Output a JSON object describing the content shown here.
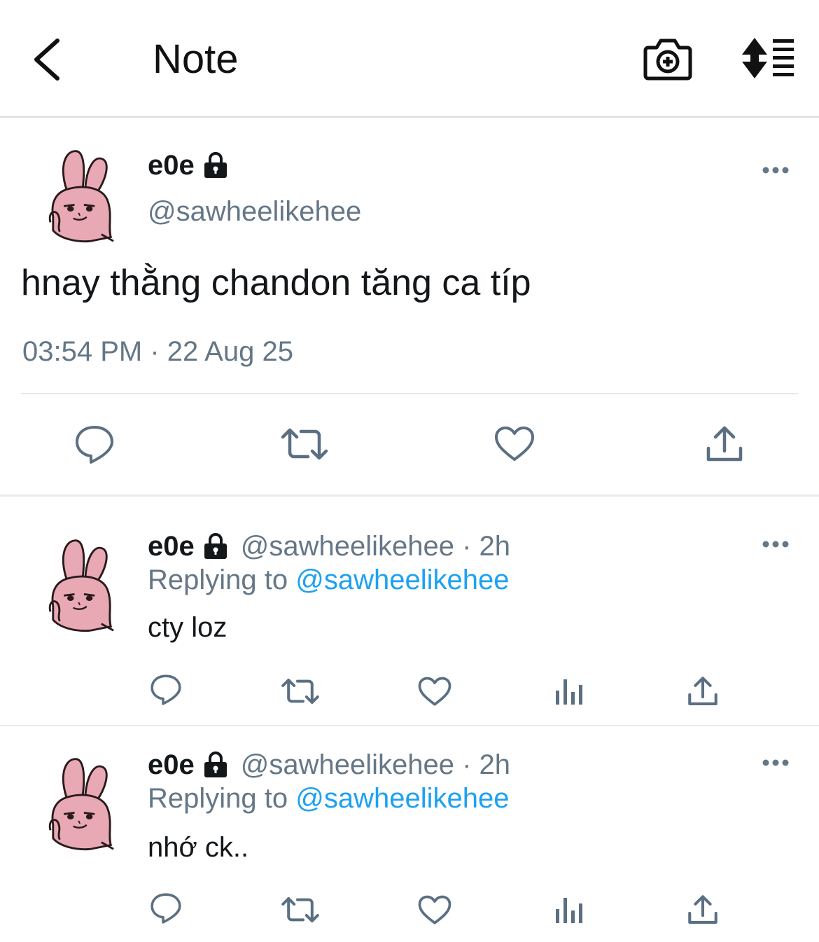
{
  "header": {
    "title": "Note",
    "back_icon": "chevron-left-icon",
    "camera_icon": "camera-plus-icon",
    "sort_icon": "sort-list-icon"
  },
  "main_tweet": {
    "display_name": "e0e",
    "handle": "@sawheelikehee",
    "text": "hnay thằng chandon tăng ca típ",
    "timestamp": "03:54 PM · 22 Aug 25",
    "actions": [
      "reply-icon",
      "retweet-icon",
      "like-icon",
      "share-icon"
    ]
  },
  "replies": [
    {
      "display_name": "e0e",
      "handle_time": "@sawheelikehee · 2h",
      "replying_prefix": "Replying to ",
      "replying_to": "@sawheelikehee",
      "text": "cty loz"
    },
    {
      "display_name": "e0e",
      "handle_time": "@sawheelikehee · 2h",
      "replying_prefix": "Replying to ",
      "replying_to": "@sawheelikehee",
      "text": "nhớ ck.."
    }
  ],
  "colors": {
    "accent": "#1da1f2",
    "secondary_text": "#657786",
    "icon": "#5b6f82",
    "avatar_pink": "#e8a9b4"
  }
}
